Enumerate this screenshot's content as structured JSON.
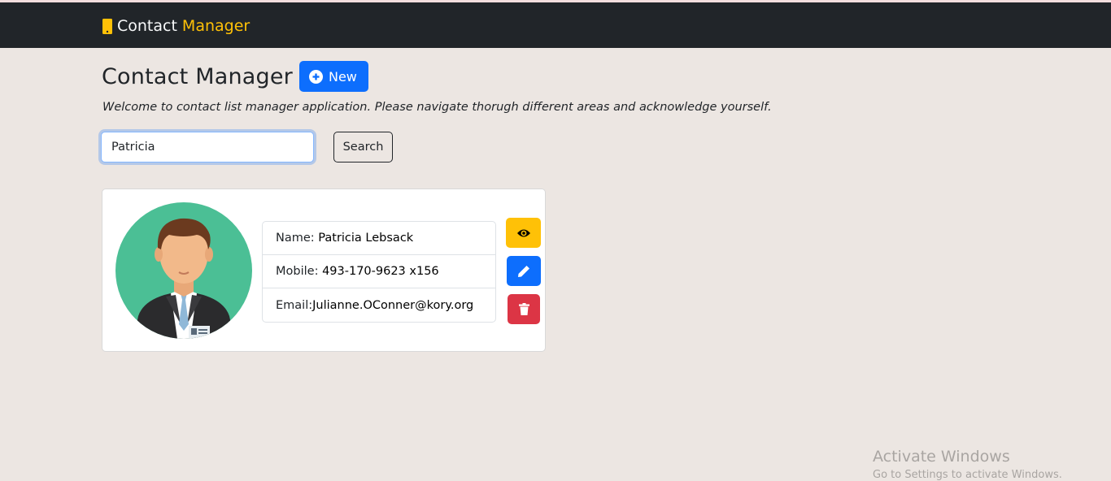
{
  "navbar": {
    "brand_text": "Contact",
    "brand_accent": "Manager",
    "brand_icon": "mobile-phone-icon",
    "accent_color": "#ffc107",
    "background_color": "#212529"
  },
  "header": {
    "title": "Contact Manager",
    "new_button_label": "New",
    "new_button_icon": "plus-circle-icon",
    "welcome_text": "Welcome to contact list manager application. Please navigate thorugh different areas and acknowledge yourself."
  },
  "search": {
    "value": "Patricia",
    "button_label": "Search"
  },
  "contacts": [
    {
      "name_label": "Name: ",
      "name": "Patricia Lebsack",
      "mobile_label": "Mobile: ",
      "mobile": "493-170-9623 x156",
      "email_label": "Email:",
      "email": "Julianne.OConner@kory.org",
      "actions": [
        {
          "icon": "eye-icon",
          "color": "#ffc107"
        },
        {
          "icon": "pencil-icon",
          "color": "#0d6efd"
        },
        {
          "icon": "trash-icon",
          "color": "#dc3545"
        }
      ]
    }
  ],
  "watermark": {
    "title": "Activate Windows",
    "subtitle": "Go to Settings to activate Windows."
  }
}
